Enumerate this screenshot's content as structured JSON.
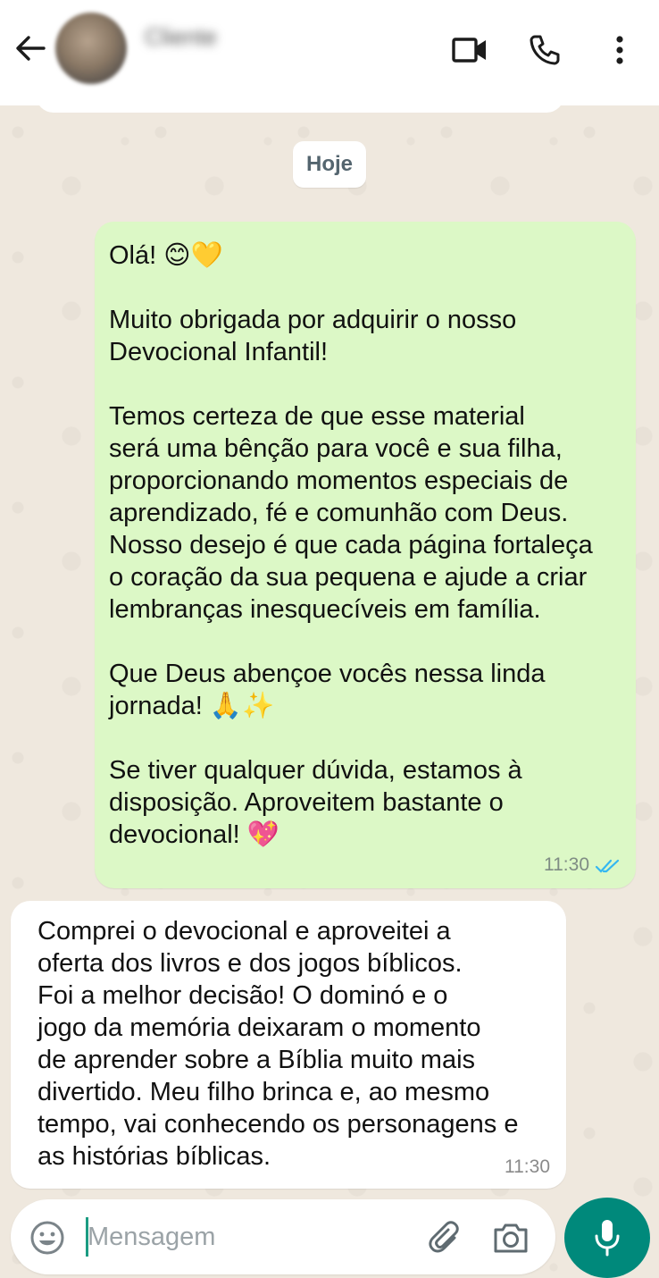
{
  "header": {
    "contact_name": "Cliente",
    "back_icon": "arrow-left-icon",
    "video_icon": "video-camera-icon",
    "call_icon": "phone-icon",
    "menu_icon": "more-vertical-icon"
  },
  "chat": {
    "date_label": "Hoje",
    "messages": [
      {
        "direction": "outgoing",
        "text": "Olá! 😊💛\n\nMuito obrigada por adquirir o nosso\nDevocional Infantil!\n\nTemos certeza de que esse material\nserá uma bênção para você e sua filha,\nproporcionando momentos especiais de\naprendizado, fé e comunhão com Deus.\nNosso desejo é que cada página fortaleça\no coração da sua pequena e ajude a criar\nlembranças inesquecíveis em família.\n\nQue Deus abençoe vocês nessa linda\njornada! 🙏✨\n\nSe tiver qualquer dúvida, estamos à\ndisposição. Aproveitem bastante o\ndevocional! 💖",
        "time": "11:30",
        "status": "read"
      },
      {
        "direction": "incoming",
        "text": "Comprei o devocional e aproveitei a\noferta dos livros e dos jogos bíblicos.\nFoi a melhor decisão! O dominó e o\njogo da memória deixaram o momento\nde aprender sobre a Bíblia muito mais\ndivertido. Meu filho brinca e, ao mesmo\ntempo, vai conhecendo os personagens e\nas histórias bíblicas.",
        "time": "11:30"
      }
    ]
  },
  "composer": {
    "placeholder": "Mensagem",
    "value": "",
    "emoji_icon": "emoji-icon",
    "attach_icon": "paperclip-icon",
    "camera_icon": "camera-icon",
    "mic_icon": "microphone-icon"
  },
  "colors": {
    "outgoing_bubble": "#dcf8c6",
    "incoming_bubble": "#ffffff",
    "accent": "#00897b",
    "read_ticks": "#34b7f1"
  }
}
